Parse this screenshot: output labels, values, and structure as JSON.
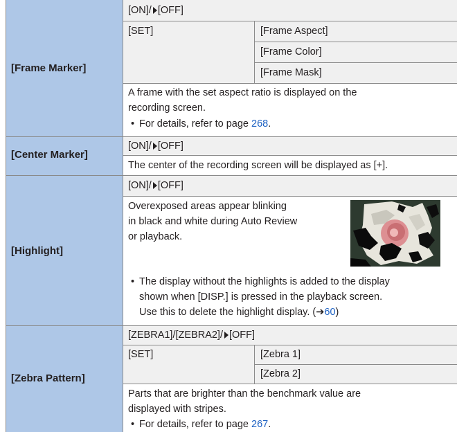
{
  "rows": {
    "frame_marker": {
      "label": "[Frame Marker]",
      "setting_on": "[ON]/",
      "setting_off": "[OFF]",
      "set_label": "[SET]",
      "options": [
        "[Frame Aspect]",
        "[Frame Color]",
        "[Frame Mask]"
      ],
      "desc_line1": "A frame with the set aspect ratio is displayed on the",
      "desc_line2": "recording screen.",
      "note_prefix": "For details, refer to page",
      "note_page": "268",
      "note_suffix": "."
    },
    "center_marker": {
      "label": "[Center Marker]",
      "setting_on": "[ON]/",
      "setting_off": "[OFF]",
      "desc": "The center of the recording screen will be displayed as [+]."
    },
    "highlight": {
      "label": "[Highlight]",
      "setting_on": "[ON]/",
      "setting_off": "[OFF]",
      "desc_line1": "Overexposed areas appear blinking",
      "desc_line2": "in black and white during Auto Review",
      "desc_line3": "or playback.",
      "note_line1": "The display without the highlights is added to the display",
      "note_line2": "shown when [DISP.] is pressed in the playback screen.",
      "note_line3_prefix": "Use this to delete the highlight display. (",
      "note_arrow": "➔",
      "note_page": "60",
      "note_line3_suffix": ")"
    },
    "zebra_pattern": {
      "label": "[Zebra Pattern]",
      "setting_prefix": "[ZEBRA1]/[ZEBRA2]/",
      "setting_off": "[OFF]",
      "set_label": "[SET]",
      "options": [
        "[Zebra 1]",
        "[Zebra 2]"
      ],
      "desc_line1": "Parts that are brighter than the benchmark value are",
      "desc_line2": "displayed with stripes.",
      "note_prefix": "For details, refer to page",
      "note_page": "267",
      "note_suffix": "."
    }
  },
  "bullet": "•"
}
